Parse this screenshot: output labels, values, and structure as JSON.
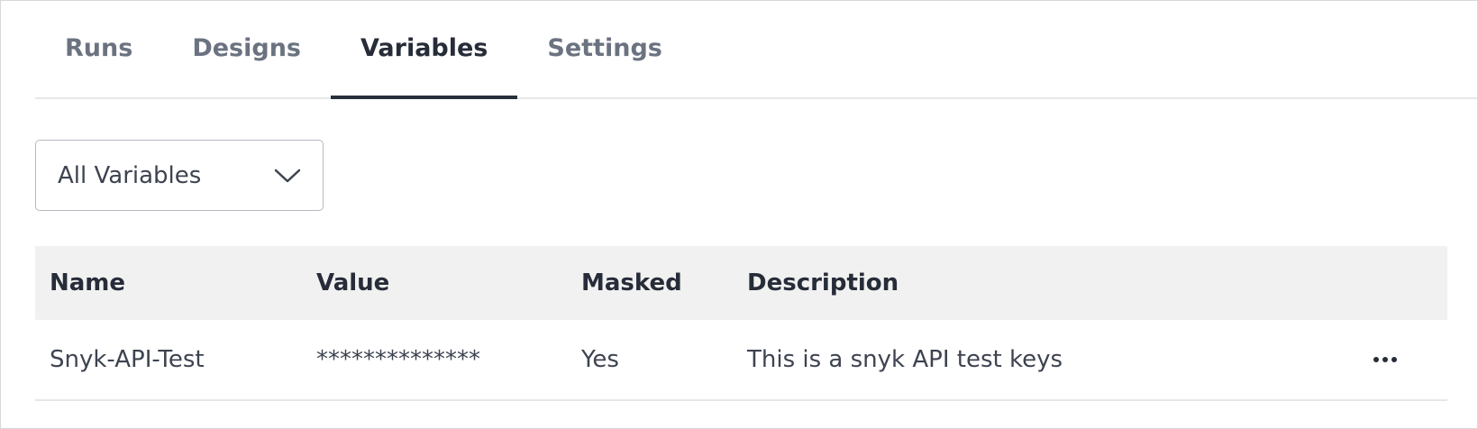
{
  "tabs": [
    {
      "label": "Runs",
      "active": false
    },
    {
      "label": "Designs",
      "active": false
    },
    {
      "label": "Variables",
      "active": true
    },
    {
      "label": "Settings",
      "active": false
    }
  ],
  "filter": {
    "selected": "All Variables",
    "icon": "chevron-down-icon"
  },
  "table": {
    "columns": [
      "Name",
      "Value",
      "Masked",
      "Description"
    ],
    "rows": [
      {
        "name": "Snyk-API-Test",
        "value": "**************",
        "masked": "Yes",
        "description": "This is a snyk API test keys",
        "actions_icon": "more-horizontal-icon"
      }
    ]
  },
  "colors": {
    "active_tab_underline": "#2a303b",
    "header_background": "#f1f1f1",
    "inactive_tab_text": "#6b7280"
  }
}
